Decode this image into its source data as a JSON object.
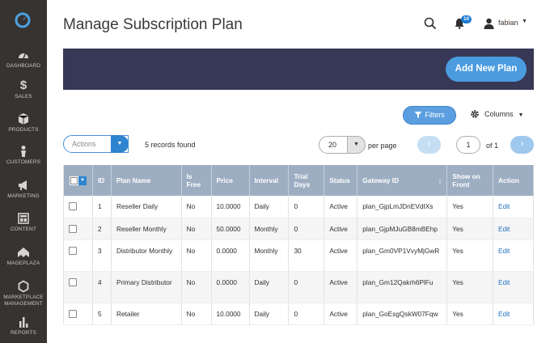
{
  "colors": {
    "sidebar": "#373330",
    "banner": "#373856",
    "accent": "#4a9cdf",
    "grid_header": "#9eaec2",
    "link": "#1f72c0"
  },
  "sidebar": {
    "items": [
      {
        "label": "DASHBOARD",
        "icon": "dashboard-icon"
      },
      {
        "label": "SALES",
        "icon": "dollar-icon"
      },
      {
        "label": "PRODUCTS",
        "icon": "cube-icon"
      },
      {
        "label": "CUSTOMERS",
        "icon": "person-icon"
      },
      {
        "label": "MARKETING",
        "icon": "megaphone-icon"
      },
      {
        "label": "CONTENT",
        "icon": "layout-icon"
      },
      {
        "label": "MAGEPLAZA",
        "icon": "mageplaza-icon"
      },
      {
        "label": "MARKETPLACE MANAGEMENT",
        "icon": "hexagon-icon"
      },
      {
        "label": "REPORTS",
        "icon": "bar-chart-icon"
      }
    ]
  },
  "header": {
    "title": "Manage Subscription Plan",
    "notifications_count": "10",
    "user_name": "fabian"
  },
  "banner": {
    "add_button": "Add New Plan"
  },
  "toolbar": {
    "filters_label": "Filters",
    "columns_label": "Columns",
    "actions_label": "Actions",
    "records_found": "5 records found",
    "per_page_value": "20",
    "per_page_label": "per page",
    "page_value": "1",
    "page_of": "of 1"
  },
  "grid": {
    "columns": [
      "ID",
      "Plan Name",
      "Is Free",
      "Price",
      "Interval",
      "Trial Days",
      "Status",
      "Gateway ID",
      "Show on Front",
      "Action"
    ],
    "rows": [
      {
        "id": "1",
        "name": "Reseller Daily",
        "is_free": "No",
        "price": "10.0000",
        "interval": "Daily",
        "trial": "0",
        "status": "Active",
        "gateway": "plan_GjpLmJDnEVdIXs",
        "show": "Yes",
        "action": "Edit"
      },
      {
        "id": "2",
        "name": "Reseller Monthly",
        "is_free": "No",
        "price": "50.0000",
        "interval": "Monthly",
        "trial": "0",
        "status": "Active",
        "gateway": "plan_GjpMJuGB8mBEhp",
        "show": "Yes",
        "action": "Edit"
      },
      {
        "id": "3",
        "name": "Distributor Monthly",
        "is_free": "No",
        "price": "0.0000",
        "interval": "Monthly",
        "trial": "30",
        "status": "Active",
        "gateway": "plan_Gm0VP1VvyMjGwR",
        "show": "Yes",
        "action": "Edit"
      },
      {
        "id": "4",
        "name": "Primary Distributor",
        "is_free": "No",
        "price": "0.0000",
        "interval": "Daily",
        "trial": "0",
        "status": "Active",
        "gateway": "plan_Gm12Qakrh6PlFu",
        "show": "Yes",
        "action": "Edit"
      },
      {
        "id": "5",
        "name": "Retailer",
        "is_free": "No",
        "price": "10.0000",
        "interval": "Daily",
        "trial": "0",
        "status": "Active",
        "gateway": "plan_GoEsgQskW07Fqw",
        "show": "Yes",
        "action": "Edit"
      }
    ]
  }
}
